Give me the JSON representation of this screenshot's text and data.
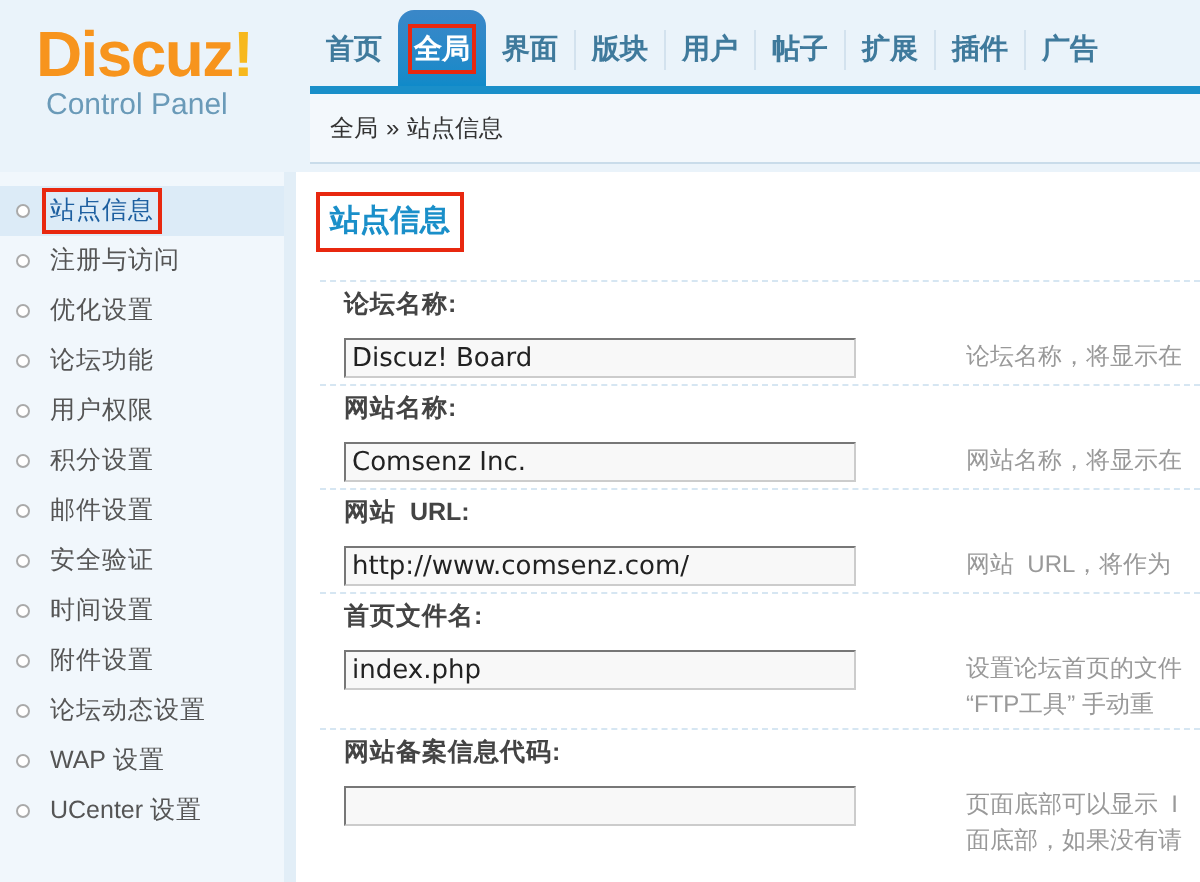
{
  "logo": {
    "brand": "Discuz",
    "mark": "!",
    "subtitle": "Control Panel"
  },
  "nav": [
    {
      "label": "首页",
      "selected": false,
      "highlighted": false
    },
    {
      "label": "全局",
      "selected": true,
      "highlighted": true
    },
    {
      "label": "界面",
      "selected": false,
      "highlighted": false
    },
    {
      "label": "版块",
      "selected": false,
      "highlighted": false
    },
    {
      "label": "用户",
      "selected": false,
      "highlighted": false
    },
    {
      "label": "帖子",
      "selected": false,
      "highlighted": false
    },
    {
      "label": "扩展",
      "selected": false,
      "highlighted": false
    },
    {
      "label": "插件",
      "selected": false,
      "highlighted": false
    },
    {
      "label": "广告",
      "selected": false,
      "highlighted": false
    }
  ],
  "breadcrumb": {
    "parent": "全局",
    "separator": "»",
    "current": "站点信息"
  },
  "sidebar": {
    "items": [
      {
        "label": "站点信息",
        "selected": true,
        "highlighted": true
      },
      {
        "label": "注册与访问",
        "selected": false,
        "highlighted": false
      },
      {
        "label": "优化设置",
        "selected": false,
        "highlighted": false
      },
      {
        "label": "论坛功能",
        "selected": false,
        "highlighted": false
      },
      {
        "label": "用户权限",
        "selected": false,
        "highlighted": false
      },
      {
        "label": "积分设置",
        "selected": false,
        "highlighted": false
      },
      {
        "label": "邮件设置",
        "selected": false,
        "highlighted": false
      },
      {
        "label": "安全验证",
        "selected": false,
        "highlighted": false
      },
      {
        "label": "时间设置",
        "selected": false,
        "highlighted": false
      },
      {
        "label": "附件设置",
        "selected": false,
        "highlighted": false
      },
      {
        "label": "论坛动态设置",
        "selected": false,
        "highlighted": false
      },
      {
        "label": "WAP 设置",
        "selected": false,
        "highlighted": false
      },
      {
        "label": "UCenter 设置",
        "selected": false,
        "highlighted": false
      }
    ]
  },
  "heading": {
    "text": "站点信息",
    "highlighted": true
  },
  "settings": [
    {
      "label": "论坛名称:",
      "value": "Discuz! Board",
      "help": [
        "论坛名称，将显示在"
      ]
    },
    {
      "label": "网站名称:",
      "value": "Comsenz Inc.",
      "help": [
        "网站名称，将显示在"
      ]
    },
    {
      "label": "网站  URL:",
      "value": "http://www.comsenz.com/",
      "help": [
        "网站  URL，将作为"
      ]
    },
    {
      "label": "首页文件名:",
      "value": "index.php",
      "help": [
        "设置论坛首页的文件",
        "“FTP工具” 手动重"
      ]
    },
    {
      "label": "网站备案信息代码:",
      "help": [
        "页面底部可以显示  I",
        "面底部，如果没有请"
      ]
    }
  ]
}
